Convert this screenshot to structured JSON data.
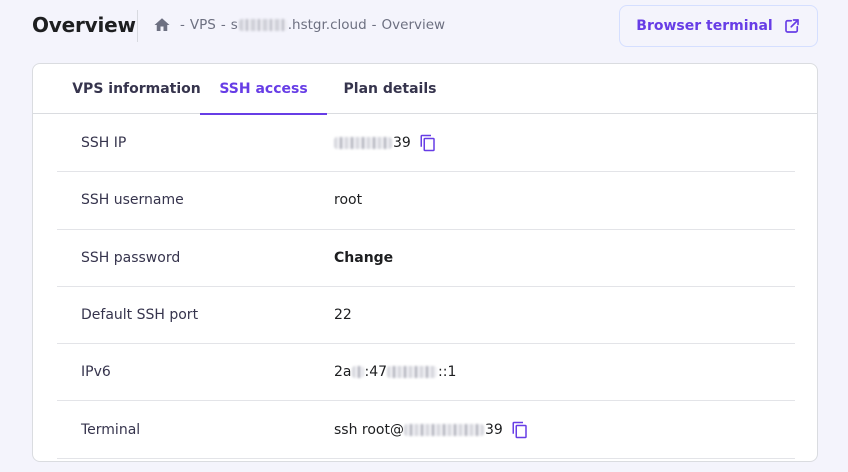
{
  "header": {
    "title": "Overview",
    "breadcrumb": {
      "section": "VPS",
      "host_prefix": "s",
      "host_suffix": ".hstgr.cloud",
      "page": "Overview",
      "separator": "-"
    },
    "browser_terminal_label": "Browser terminal"
  },
  "tabs": [
    {
      "label": "VPS information",
      "active": false
    },
    {
      "label": "SSH access",
      "active": true
    },
    {
      "label": "Plan details",
      "active": false
    }
  ],
  "rows": {
    "ssh_ip": {
      "label": "SSH IP",
      "value_suffix": "39"
    },
    "ssh_username": {
      "label": "SSH username",
      "value": "root"
    },
    "ssh_password": {
      "label": "SSH password",
      "action": "Change"
    },
    "ssh_port": {
      "label": "Default SSH port",
      "value": "22"
    },
    "ipv6": {
      "label": "IPv6",
      "value_prefix": "2a",
      "value_mid": ":47",
      "value_suffix": "::1"
    },
    "terminal": {
      "label": "Terminal",
      "value_prefix": "ssh root@",
      "value_suffix": "39"
    }
  },
  "colors": {
    "accent": "#673de6",
    "background": "#f4f4fc",
    "card": "#ffffff"
  },
  "icons": {
    "home": "home-icon",
    "external": "external-link-icon",
    "copy": "copy-icon"
  }
}
